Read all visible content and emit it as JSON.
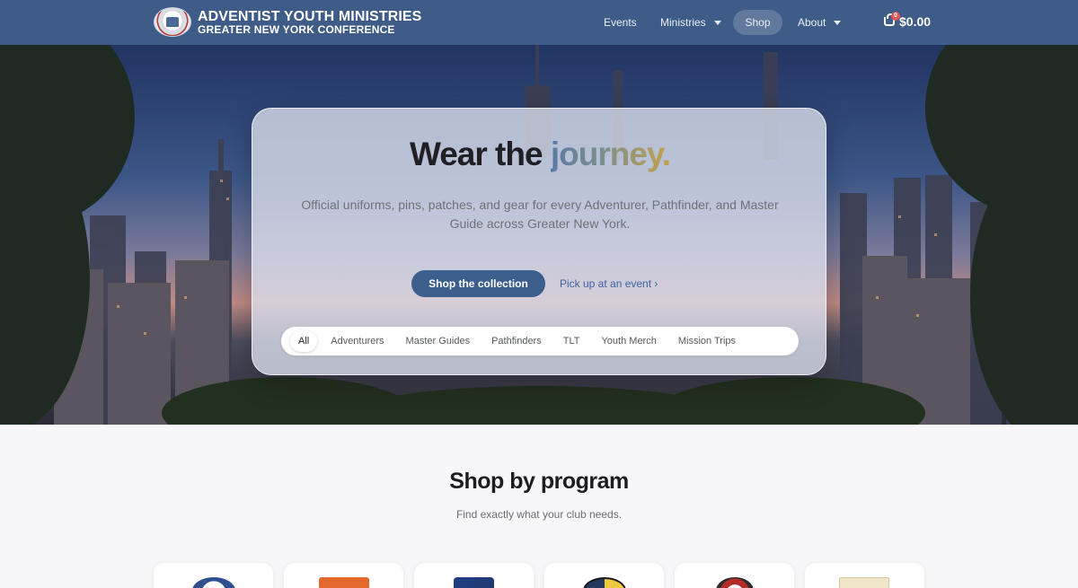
{
  "header": {
    "brand_line1": "ADVENTIST YOUTH MINISTRIES",
    "brand_line2": "GREATER NEW YORK CONFERENCE",
    "nav": [
      {
        "label": "Events"
      },
      {
        "label": "Ministries"
      },
      {
        "label": "Shop"
      },
      {
        "label": "About"
      }
    ],
    "cart_count": "0",
    "cart_total": "$0.00"
  },
  "hero": {
    "title_main": "Wear the",
    "title_accent": "journey.",
    "subtitle": "Official uniforms, pins, patches, and gear for every Adventurer, Pathfinder, and Master Guide across Greater New York.",
    "primary_button": "Shop the collection",
    "secondary_link": "Pick up at an event ›",
    "filters": [
      "All",
      "Adventurers",
      "Master Guides",
      "Pathfinders",
      "TLT",
      "Youth Merch",
      "Mission Trips"
    ],
    "active_filter": "All"
  },
  "section": {
    "title": "Shop by program",
    "subtitle": "Find exactly what your club needs."
  },
  "colors": {
    "header_bg": "#3e5c87",
    "primary_button": "#3b5e8c",
    "link": "#3d63a0",
    "badge": "#e25555"
  },
  "cards": [
    {
      "icon": "adventurer-badge-icon"
    },
    {
      "icon": "pathfinder-badge-icon"
    },
    {
      "icon": "master-guide-badge-icon"
    },
    {
      "icon": "tlt-badge-icon"
    },
    {
      "icon": "youth-badge-icon"
    },
    {
      "icon": "mission-trips-icon"
    }
  ]
}
